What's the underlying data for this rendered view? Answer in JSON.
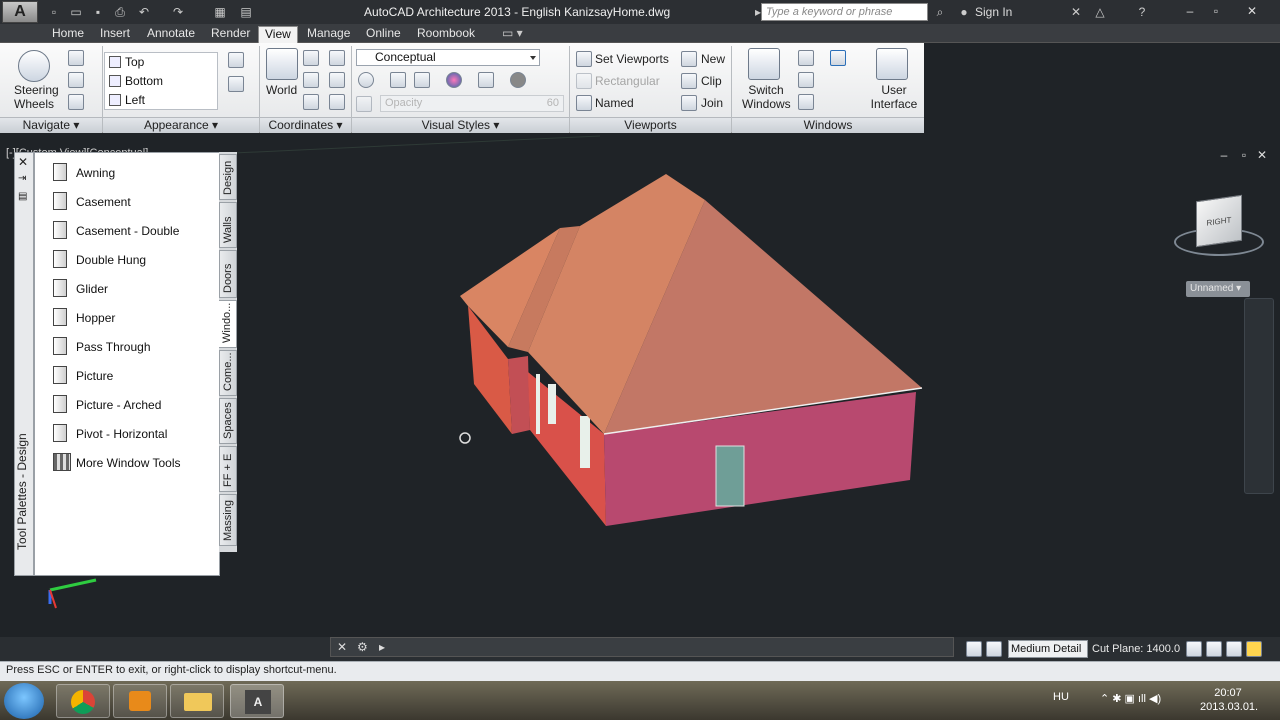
{
  "window": {
    "title": "AutoCAD Architecture 2013 - English    KanizsayHome.dwg",
    "app_logo": "A",
    "search_placeholder": "Type a keyword or phrase",
    "sign_in": "Sign In"
  },
  "tabs": [
    "Home",
    "Insert",
    "Annotate",
    "Render",
    "View",
    "Manage",
    "Online",
    "Roombook"
  ],
  "active_tab": "View",
  "ribbon": {
    "navigate": {
      "steering_wheels": "Steering Wheels",
      "footer": "Navigate"
    },
    "appearance": {
      "views": [
        "Top",
        "Bottom",
        "Left"
      ],
      "footer": "Appearance"
    },
    "coordinates": {
      "world": "World",
      "footer": "Coordinates"
    },
    "visual_styles": {
      "current": "Conceptual",
      "opacity_placeholder": "Opacity",
      "opacity_value": "60",
      "footer": "Visual Styles"
    },
    "viewports": {
      "set_viewports": "Set Viewports",
      "rectangular": "Rectangular",
      "named": "Named",
      "new": "New",
      "clip": "Clip",
      "join": "Join",
      "footer": "Viewports"
    },
    "windows": {
      "switch_windows": "Switch Windows",
      "user_interface": "User Interface",
      "footer": "Windows"
    }
  },
  "viewport": {
    "label": "[-][Custom View][Conceptual]",
    "ucs_named": "Unnamed",
    "viewcube_face": "RIGHT"
  },
  "tool_palette": {
    "title": "Tool Palettes - Design",
    "items": [
      "Awning",
      "Casement",
      "Casement - Double",
      "Double Hung",
      "Glider",
      "Hopper",
      "Pass Through",
      "Picture",
      "Picture - Arched",
      "Pivot - Horizontal",
      "More Window Tools"
    ],
    "tabs": [
      "Design",
      "Walls",
      "Doors",
      "Windo...",
      "Come...",
      "Spaces",
      "FF + E",
      "Massing"
    ],
    "active_tab": "Windo..."
  },
  "statusbar": {
    "message": "Press ESC or ENTER to exit, or right-click to display shortcut-menu.",
    "detail": "Medium Detail",
    "cut_plane": "Cut Plane:  1400.0"
  },
  "taskbar": {
    "language": "HU",
    "time": "20:07",
    "date": "2013.03.01."
  },
  "colors": {
    "roof": "#d98563",
    "wall_front": "#b8496f",
    "wall_side": "#d95a46",
    "background": "#1f2327"
  }
}
